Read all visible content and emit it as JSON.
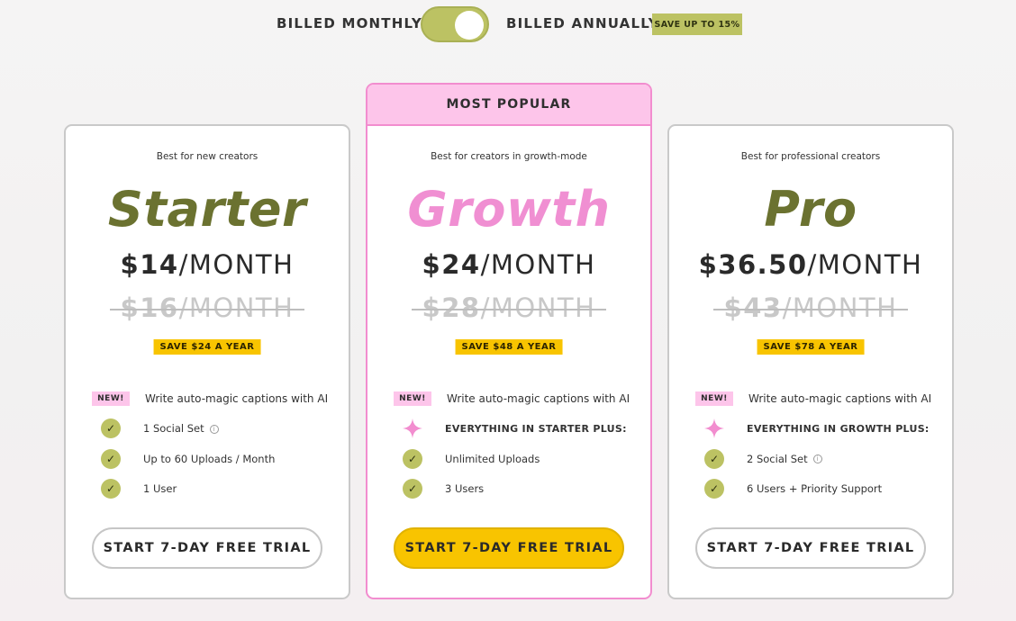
{
  "billing": {
    "monthly_label": "BILLED MONTHLY",
    "annual_label": "BILLED ANNUALLY",
    "toggle_state": "annual",
    "save_badge": "SAVE UP TO 15%"
  },
  "colors": {
    "olive": "#6b7230",
    "olive_light": "#bcc263",
    "pink": "#f28dcf",
    "pink_light": "#fdc5ea",
    "yellow": "#f8c400"
  },
  "plans": [
    {
      "tagline": "Best for new creators",
      "name": "Starter",
      "price": "$14",
      "per": "/MONTH",
      "old_price": "$16",
      "old_per": "/MONTH",
      "save": "SAVE $24 A YEAR",
      "features": [
        {
          "icon": "new-badge",
          "badge": "NEW!",
          "text": "Write auto-magic captions with AI"
        },
        {
          "icon": "check-icon",
          "text": "1 Social Set"
        },
        {
          "icon": "check-icon",
          "text": "Up to 60 Uploads / Month"
        },
        {
          "icon": "check-icon",
          "text": "1 User"
        }
      ],
      "cta": "START 7-DAY FREE TRIAL"
    },
    {
      "popular_label": "MOST POPULAR",
      "tagline": "Best for creators in growth-mode",
      "name": "Growth",
      "price": "$24",
      "per": "/MONTH",
      "old_price": "$28",
      "old_per": "/MONTH",
      "save": "SAVE $48 A YEAR",
      "features": [
        {
          "icon": "new-badge",
          "badge": "NEW!",
          "text": "Write auto-magic captions with AI"
        },
        {
          "icon": "sparkle-icon",
          "text": "EVERYTHING IN STARTER PLUS:"
        },
        {
          "icon": "check-icon",
          "text": "Unlimited Uploads"
        },
        {
          "icon": "check-icon",
          "text": "3 Users"
        }
      ],
      "cta": "START 7-DAY FREE TRIAL"
    },
    {
      "tagline": "Best for professional creators",
      "name": "Pro",
      "price": "$36.50",
      "per": "/MONTH",
      "old_price": "$43",
      "old_per": "/MONTH",
      "save": "SAVE $78 A YEAR",
      "features": [
        {
          "icon": "new-badge",
          "badge": "NEW!",
          "text": "Write auto-magic captions with AI"
        },
        {
          "icon": "sparkle-icon",
          "text": "EVERYTHING IN GROWTH PLUS:"
        },
        {
          "icon": "check-icon",
          "text": "2 Social Set"
        },
        {
          "icon": "check-icon",
          "text": "6 Users + Priority Support"
        }
      ],
      "cta": "START 7-DAY FREE TRIAL"
    }
  ]
}
